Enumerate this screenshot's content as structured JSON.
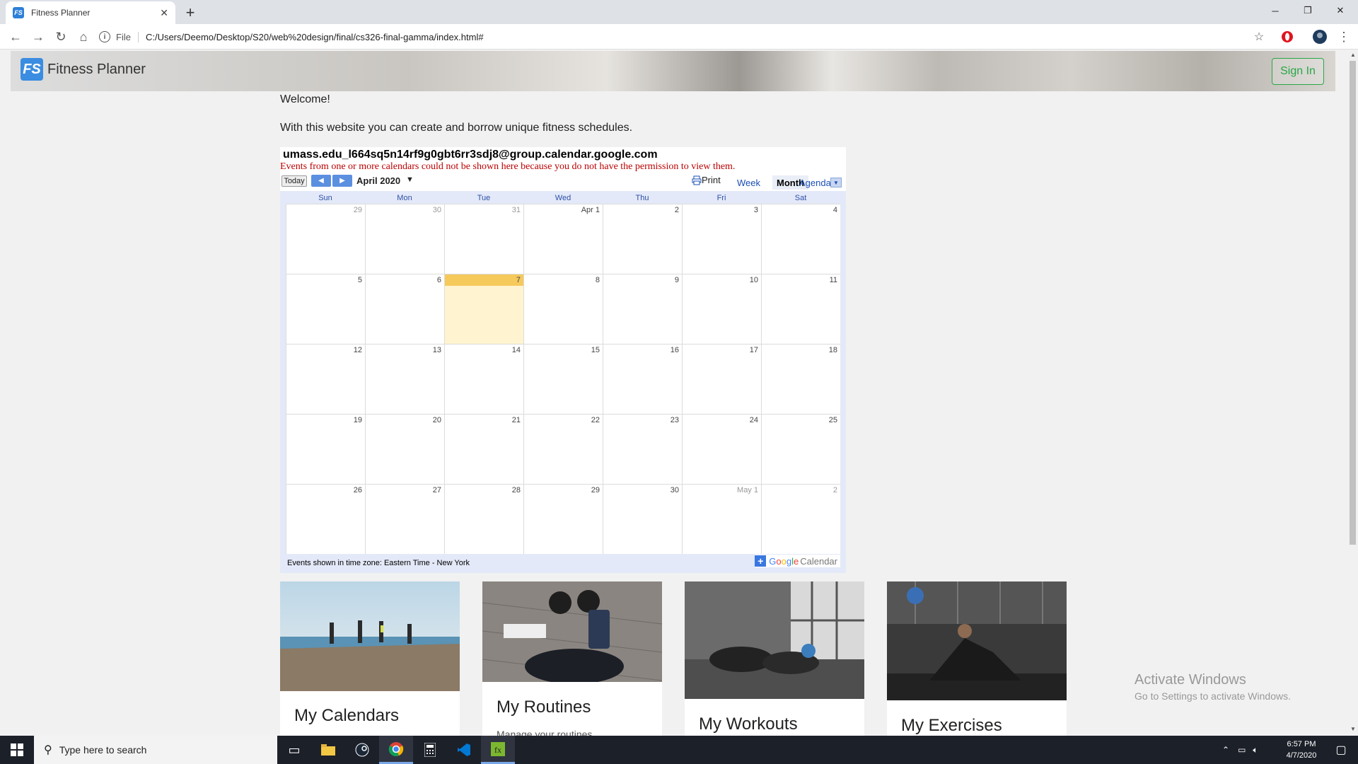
{
  "browser": {
    "tab_title": "Fitness Planner",
    "tab_favicon": "FS",
    "address_scheme": "File",
    "address_url": "C:/Users/Deemo/Desktop/S20/web%20design/final/cs326-final-gamma/index.html#"
  },
  "navbar": {
    "brand_logo": "FS",
    "brand_name": "Fitness Planner",
    "sign_in_label": "Sign In"
  },
  "content": {
    "welcome": "Welcome!",
    "description": "With this website you can create and borrow unique fitness schedules."
  },
  "calendar": {
    "title": "umass.edu_l664sq5n14rf9g0gbt6rr3sdj8@group.calendar.google.com",
    "warning": "Events from one or more calendars could not be shown here because you do not have the permission to view them.",
    "today_label": "Today",
    "month_label": "April 2020",
    "print_label": "Print",
    "views": [
      "Week",
      "Month",
      "Agenda"
    ],
    "active_view": "Month",
    "days_of_week": [
      "Sun",
      "Mon",
      "Tue",
      "Wed",
      "Thu",
      "Fri",
      "Sat"
    ],
    "weeks": [
      [
        "29",
        "30",
        "31",
        "Apr 1",
        "2",
        "3",
        "4"
      ],
      [
        "5",
        "6",
        "7",
        "8",
        "9",
        "10",
        "11"
      ],
      [
        "12",
        "13",
        "14",
        "15",
        "16",
        "17",
        "18"
      ],
      [
        "19",
        "20",
        "21",
        "22",
        "23",
        "24",
        "25"
      ],
      [
        "26",
        "27",
        "28",
        "29",
        "30",
        "May 1",
        "2"
      ]
    ],
    "today": "7",
    "timezone_text": "Events shown in time zone: Eastern Time - New York",
    "google_brand": "Google",
    "calendar_word": "Calendar"
  },
  "cards": [
    {
      "title": "My Calendars",
      "subtitle": ""
    },
    {
      "title": "My Routines",
      "subtitle": "Manage your routines"
    },
    {
      "title": "My Workouts",
      "subtitle": ""
    },
    {
      "title": "My Exercises",
      "subtitle": ""
    }
  ],
  "watermark": {
    "line1": "Activate Windows",
    "line2": "Go to Settings to activate Windows."
  },
  "taskbar": {
    "search_placeholder": "Type here to search",
    "time": "6:57 PM",
    "date": "4/7/2020"
  }
}
